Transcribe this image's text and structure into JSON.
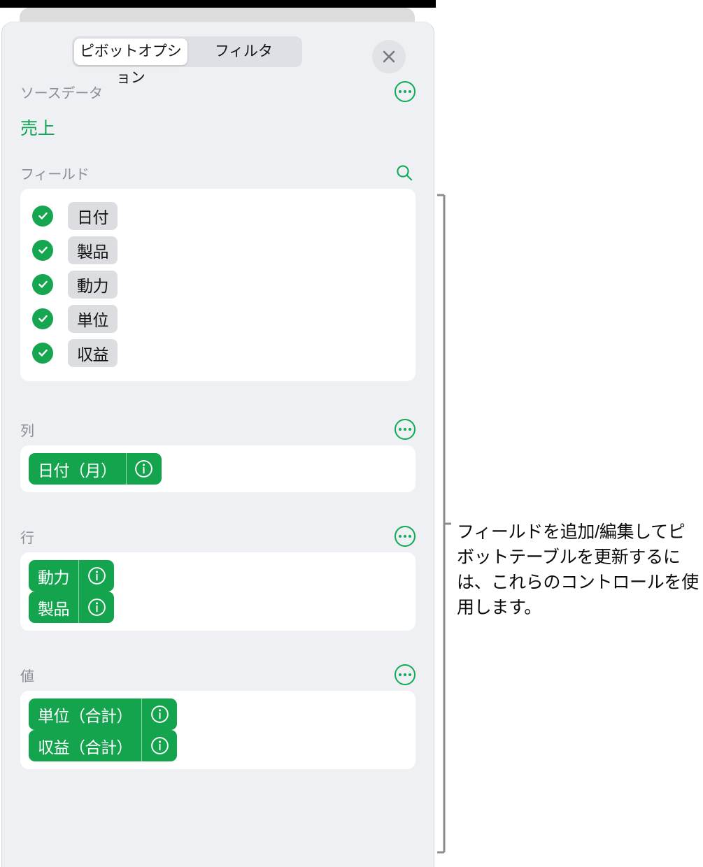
{
  "header": {
    "tabs": [
      {
        "label": "ピボットオプション",
        "active": true
      },
      {
        "label": "フィルタ",
        "active": false
      }
    ],
    "close_icon": "close-icon"
  },
  "source_data": {
    "label": "ソースデータ",
    "value": "売上",
    "more_icon": "ellipsis-circle-icon"
  },
  "fields": {
    "label": "フィールド",
    "search_icon": "search-icon",
    "items": [
      {
        "label": "日付",
        "checked": true
      },
      {
        "label": "製品",
        "checked": true
      },
      {
        "label": "動力",
        "checked": true
      },
      {
        "label": "単位",
        "checked": true
      },
      {
        "label": "収益",
        "checked": true
      }
    ]
  },
  "columns": {
    "label": "列",
    "more_icon": "ellipsis-circle-icon",
    "tokens": [
      {
        "label": "日付（月）",
        "info_icon": "info-icon"
      }
    ]
  },
  "rows": {
    "label": "行",
    "more_icon": "ellipsis-circle-icon",
    "tokens": [
      {
        "label": "動力",
        "info_icon": "info-icon"
      },
      {
        "label": "製品",
        "info_icon": "info-icon"
      }
    ]
  },
  "values": {
    "label": "値",
    "more_icon": "ellipsis-circle-icon",
    "tokens": [
      {
        "label": "単位（合計）",
        "info_icon": "info-icon"
      },
      {
        "label": "収益（合計）",
        "info_icon": "info-icon"
      }
    ]
  },
  "callout": {
    "text": "フィールドを追加/編集してピボットテーブルを更新するには、これらのコントロールを使用します。"
  },
  "colors": {
    "green": "#14a44e",
    "green_text": "#12a454",
    "panel_bg": "#eef0f4",
    "card_bg": "#ffffff",
    "chip_bg": "#dcdde1",
    "muted_text": "#8c8d92"
  }
}
